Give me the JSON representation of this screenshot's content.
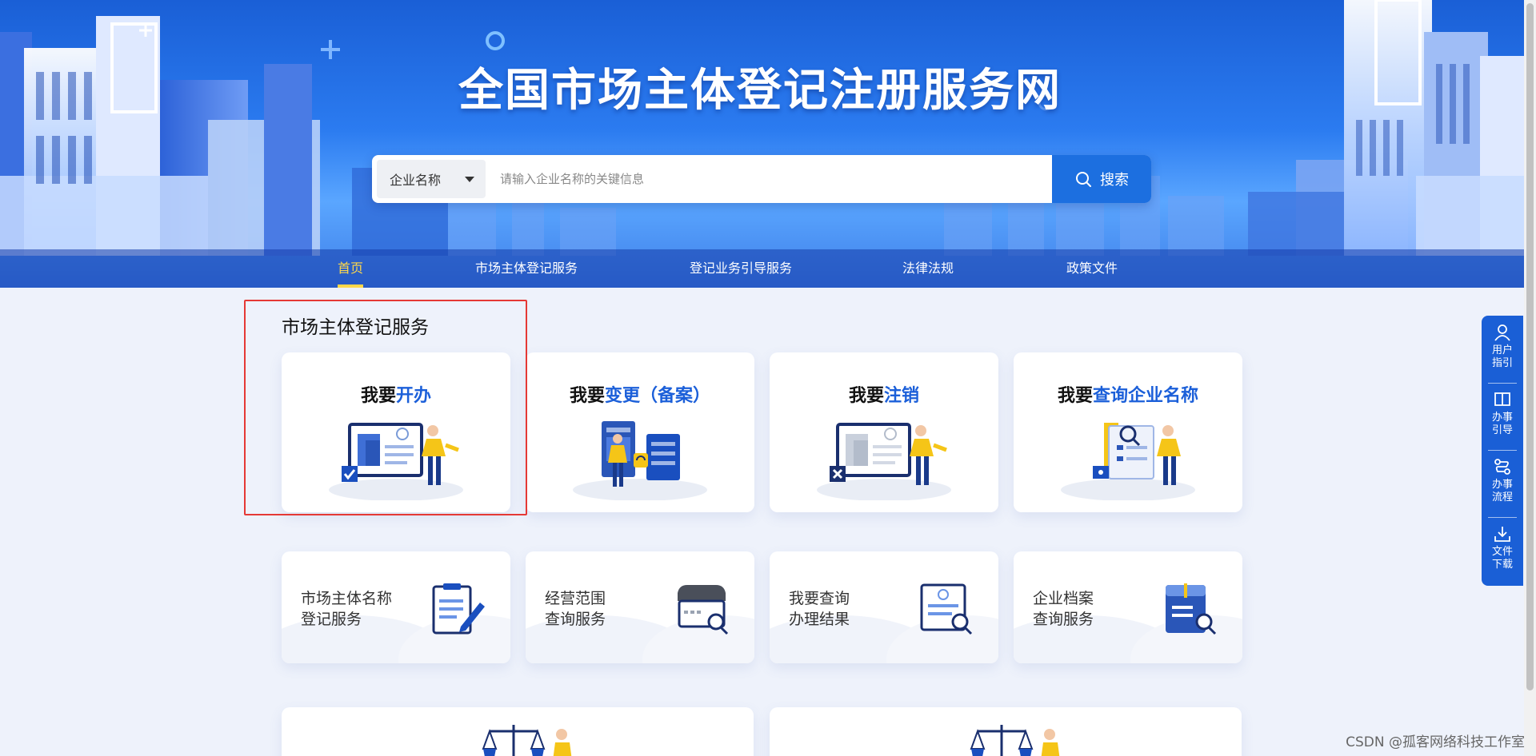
{
  "header": {
    "site_title": "全国市场主体登记注册服务网",
    "search": {
      "type_label": "企业名称",
      "placeholder": "请输入企业名称的关键信息",
      "button_label": "搜索"
    },
    "nav": [
      {
        "label": "首页",
        "active": true
      },
      {
        "label": "市场主体登记服务",
        "active": false
      },
      {
        "label": "登记业务引导服务",
        "active": false
      },
      {
        "label": "法律法规",
        "active": false
      },
      {
        "label": "政策文件",
        "active": false
      }
    ]
  },
  "main": {
    "section_title": "市场主体登记服务",
    "main_cards": [
      {
        "prefix": "我要",
        "highlight": "开办",
        "icon": "open-business-illustration"
      },
      {
        "prefix": "我要",
        "highlight": "变更（备案）",
        "icon": "change-filing-illustration"
      },
      {
        "prefix": "我要",
        "highlight": "注销",
        "icon": "deregister-illustration"
      },
      {
        "prefix": "我要",
        "highlight": "查询企业名称",
        "icon": "query-name-illustration"
      }
    ],
    "service_cards": [
      {
        "label": "市场主体名称\n登记服务",
        "icon": "clipboard-pen-icon"
      },
      {
        "label": "经营范围\n查询服务",
        "icon": "shop-search-icon"
      },
      {
        "label": "我要查询\n办理结果",
        "icon": "certificate-search-icon"
      },
      {
        "label": "企业档案\n查询服务",
        "icon": "archive-search-icon"
      }
    ]
  },
  "float_toolbar": [
    {
      "label": "用户\n指引",
      "icon": "user-icon"
    },
    {
      "label": "办事\n引导",
      "icon": "book-icon"
    },
    {
      "label": "办事\n流程",
      "icon": "flow-icon"
    },
    {
      "label": "文件\n下载",
      "icon": "download-icon"
    }
  ],
  "watermark": "CSDN @孤客网络科技工作室",
  "colors": {
    "brand_blue": "#1b5fd9",
    "nav_active": "#ffd84a",
    "highlight_box": "#e53935",
    "accent_yellow": "#f5c518"
  }
}
